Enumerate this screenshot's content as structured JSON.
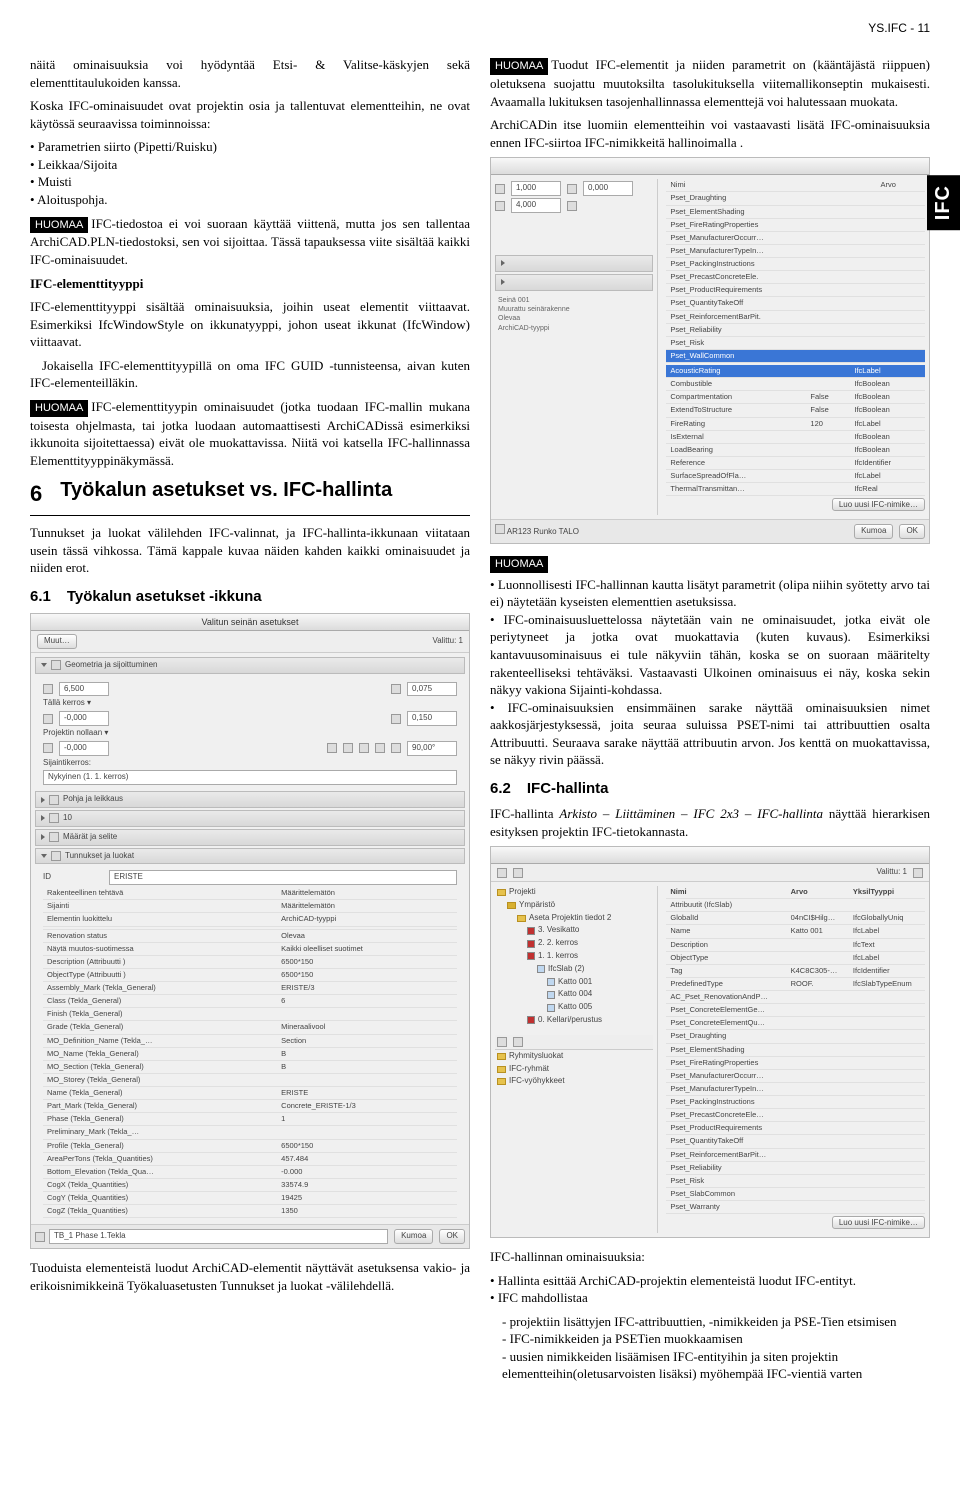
{
  "header": {
    "pageref": "YS.IFC - 11"
  },
  "sidetab": "IFC",
  "left": {
    "p1": "näitä ominaisuuksia voi hyödyntää Etsi- & Valitse-käskyjen sekä elementtitaulukoiden kanssa.",
    "p2": "Koska IFC-ominaisuudet ovat projektin osia ja tallentuvat elementteihin, ne ovat käytössä seuraavissa toiminnoissa:",
    "list1": [
      "Parametrien siirto (Pipetti/Ruisku)",
      "Leikkaa/Sijoita",
      "Muisti",
      "Aloituspohja."
    ],
    "note1": "IFC-tiedostoa ei voi suoraan käyttää viittenä, mutta jos sen tallentaa ArchiCAD.PLN-tiedostoksi, sen voi sijoittaa. Tässä tapauksessa viite sisältää kaikki IFC-ominaisuudet.",
    "h1": "IFC-elementtityyppi",
    "p3": "IFC-elementtityyppi sisältää ominaisuuksia, joihin useat elementit viittaavat. Esimerkiksi IfcWindowStyle on ikkunatyyppi, johon useat ikkunat (IfcWindow) viittaavat.",
    "p4": "Jokaisella IFC-elementtityypillä on oma IFC GUID -tunnisteensa, aivan kuten IFC-elementeilläkin.",
    "note2": "IFC-elementtityypin ominaisuudet (jotka tuodaan IFC-mallin mukana toisesta ohjelmasta, tai jotka luodaan automaattisesti ArchiCADissä esimerkiksi ikkunoita sijoitettaessa) eivät ole muokattavissa. Niitä voi katsella IFC-hallinnassa Elementtityyppinäkymässä.",
    "sec6num": "6",
    "sec6title": "Työkalun asetukset vs. IFC-hallinta",
    "p5": "Tunnukset ja luokat välilehden IFC-valinnat, ja IFC-hallinta-ikkunaan viitataan usein tässä vihkossa. Tämä kappale kuvaa näiden kahden kaikki ominaisuudet ja niiden erot.",
    "sub61num": "6.1",
    "sub61title": "Työkalun asetukset -ikkuna",
    "p6": "Tuoduista elementeistä luodut ArchiCAD-elementit näyttävät asetuksensa vakio- ja erikoisnimikkeinä Työkaluasetusten Tunnukset ja luokat -välilehdellä.",
    "ss1": {
      "title": "Valitun seinän asetukset",
      "muut": "Muut…",
      "valittu": "Valittu: 1",
      "geom": "Geometria ja sijoittuminen",
      "v1": "6,500",
      "v2": "0,075",
      "v3": "-0,000",
      "v4": "0,150",
      "talla": "Tällä kerros ▾",
      "proj": "Projektin nollaan ▾",
      "v5": "-0,000",
      "angle": "90,00°",
      "sijk": "Sijaintikerros:",
      "ker": "Nykyinen (1. 1. kerros)",
      "pohja": "Pohja ja leikkaus",
      "n10": "10",
      "maarat": "Määrät ja selite",
      "tunn": "Tunnukset ja luokat",
      "id": "ID",
      "eriste": "ERISTE",
      "rows": [
        [
          "Rakenteellinen tehtävä",
          "Määrittelemätön"
        ],
        [
          "Sijainti",
          "Määrittelemätön"
        ],
        [
          "Elementin luokittelu",
          "ArchiCAD-tyyppi"
        ],
        [
          "",
          ""
        ],
        [
          "Renovation status",
          "Olevaa"
        ],
        [
          "Näytä muutos-suotimessa",
          "Kaikki oleelliset suotimet"
        ],
        [
          "Description (Attribuutti )",
          "6500*150"
        ],
        [
          "ObjectType (Attribuutti )",
          "6500*150"
        ],
        [
          "Assembly_Mark (Tekla_General)",
          "ERISTE/3"
        ],
        [
          "Class (Tekla_General)",
          "6"
        ],
        [
          "Finish (Tekla_General)",
          ""
        ],
        [
          "Grade (Tekla_General)",
          "Mineraalivool"
        ],
        [
          "MO_Definition_Name (Tekla_…",
          "Section"
        ],
        [
          "MO_Name (Tekla_General)",
          "B"
        ],
        [
          "MO_Section (Tekla_General)",
          "B"
        ],
        [
          "MO_Storey (Tekla_General)",
          ""
        ],
        [
          "Name (Tekla_General)",
          "ERISTE"
        ],
        [
          "Part_Mark (Tekla_General)",
          "Concrete_ERISTE-1/3"
        ],
        [
          "Phase (Tekla_General)",
          "1"
        ],
        [
          "Preliminary_Mark (Tekla_…",
          ""
        ],
        [
          "Profile (Tekla_General)",
          "6500*150"
        ],
        [
          "AreaPerTons (Tekla_Quantities)",
          "457.484"
        ],
        [
          "Bottom_Elevation (Tekla_Qua…",
          "-0.000"
        ],
        [
          "CogX (Tekla_Quantities)",
          "33574.9"
        ],
        [
          "CogY (Tekla_Quantities)",
          "19425"
        ],
        [
          "CogZ (Tekla_Quantities)",
          "1350"
        ]
      ],
      "layer": "TB_1 Phase 1.Tekla",
      "kumoa": "Kumoa",
      "ok": "OK"
    }
  },
  "right": {
    "note1": "Tuodut IFC-elementit ja niiden parametrit on (kääntäjästä riippuen) oletuksena suojattu muutoksilta tasolukituksella viitemallikonseptin mukaisesti. Avaamalla lukituksen tasojenhallinnassa elementtejä voi halutessaan muokata.",
    "p1": "ArchiCADin itse luomiin elementteihin voi vastaavasti lisätä IFC-ominaisuuksia ennen IFC-siirtoa IFC-nimikkeitä hallinoimalla .",
    "ss2": {
      "left1": "1,000",
      "left2": "0,000",
      "left3": "4,000",
      "props": [
        [
          "Nimi",
          "Arvo"
        ],
        [
          "Pset_Draughting",
          ""
        ],
        [
          "Pset_ElementShading",
          ""
        ],
        [
          "Pset_FireRatingProperties",
          ""
        ],
        [
          "Pset_ManufacturerOccurr…",
          ""
        ],
        [
          "Pset_ManufacturerTypeIn…",
          ""
        ],
        [
          "Pset_PackingInstructions",
          ""
        ],
        [
          "Pset_PrecastConcreteEle.",
          ""
        ],
        [
          "Pset_ProductRequirements",
          ""
        ],
        [
          "Pset_QuantityTakeOff",
          ""
        ],
        [
          "Pset_ReinforcementBarPit.",
          ""
        ],
        [
          "Pset_Reliability",
          ""
        ],
        [
          "Pset_Risk",
          ""
        ],
        [
          "Pset_WallCommon",
          ""
        ]
      ],
      "sel": [
        [
          "AcousticRating",
          "",
          "IfcLabel"
        ],
        [
          "Combustible",
          "",
          "IfcBoolean"
        ],
        [
          "Compartmentation",
          "False",
          "IfcBoolean"
        ],
        [
          "ExtendToStructure",
          "False",
          "IfcBoolean"
        ],
        [
          "FireRating",
          "120",
          "IfcLabel"
        ],
        [
          "IsExternal",
          "",
          "IfcBoolean"
        ],
        [
          "LoadBearing",
          "",
          "IfcBoolean"
        ],
        [
          "Reference",
          "",
          "IfcIdentifier"
        ],
        [
          "SurfaceSpreadOfFla…",
          "",
          "IfcLabel"
        ],
        [
          "ThermalTransmittan…",
          "",
          "IfcReal"
        ]
      ],
      "bottom": "AR123 Runko TALO",
      "kumoa": "Kumoa",
      "ok": "OK",
      "uusi": "Luo uusi IFC-nimike…"
    },
    "note2label": "HUOMAA",
    "list2": [
      "Luonnollisesti IFC-hallinnan kautta lisätyt parametrit (olipa niihin syötetty arvo tai ei) näytetään kyseisten elementtien asetuksissa.",
      "IFC-ominaisuusluettelossa näytetään vain ne ominaisuudet, jotka eivät ole periytyneet ja jotka ovat muokattavia (kuten kuvaus). Esimerkiksi kantavuusominaisuus ei tule näkyviin tähän, koska se on suoraan määritelty rakenteelliseksi tehtäväksi. Vastaavasti Ulkoinen ominaisuus ei näy, koska sekin näkyy vakiona Sijainti-kohdassa.",
      "IFC-ominaisuuksien ensimmäinen sarake näyttää ominaisuuksien nimet aakkosjärjestyksessä, joita seuraa suluissa PSET-nimi tai attribuuttien osalta Attribuutti. Seuraava sarake näyttää attribuutin arvon. Jos kenttä on muokattavissa, se näkyy rivin päässä."
    ],
    "sub62num": "6.2",
    "sub62title": "IFC-hallinta",
    "p2a": "IFC-hallinta ",
    "p2b": "Arkisto – Liittäminen – IFC 2x3 – IFC-hallinta",
    "p2c": " näyttää hierarkisen esityksen projektin IFC-tietokannasta.",
    "ss3": {
      "valittu": "Valittu: 1",
      "tree": [
        {
          "label": "Projekti",
          "type": "folder",
          "depth": 0
        },
        {
          "label": "Ympäristö",
          "type": "folder",
          "depth": 1,
          "color": "#d8b030"
        },
        {
          "label": "Aseta Projektin tiedot 2",
          "type": "folder",
          "depth": 2
        },
        {
          "label": "3. Vesikatto",
          "type": "item",
          "depth": 3,
          "color": "#c03030"
        },
        {
          "label": "2. 2. kerros",
          "type": "item",
          "depth": 3,
          "color": "#c03030"
        },
        {
          "label": "1. 1. kerros",
          "type": "item",
          "depth": 3,
          "color": "#c03030"
        },
        {
          "label": "IfcSlab (2)",
          "type": "item",
          "depth": 4
        },
        {
          "label": "Katto 001",
          "type": "item",
          "depth": 5
        },
        {
          "label": "Katto 004",
          "type": "item",
          "depth": 5
        },
        {
          "label": "Katto 005",
          "type": "item",
          "depth": 5
        },
        {
          "label": "0. Kellari/perustus",
          "type": "item",
          "depth": 3,
          "color": "#c03030"
        }
      ],
      "groups": [
        "Ryhmitysluokat",
        "IFC-ryhmät",
        "IFC-vyöhykkeet"
      ],
      "propsHeader": [
        "Nimi",
        "Arvo",
        "YksilTyyppi"
      ],
      "props": [
        [
          "Attribuutit (IfcSlab)",
          "",
          ""
        ],
        [
          "GlobalId",
          "04nCI$Hilg…",
          "IfcGloballyUniq"
        ],
        [
          "Name",
          "Katto 001",
          "IfcLabel"
        ],
        [
          "Description",
          "",
          "IfcText"
        ],
        [
          "ObjectType",
          "",
          "IfcLabel"
        ],
        [
          "Tag",
          "K4C8C305-…",
          "IfcIdentifier"
        ],
        [
          "PredefinedType",
          "ROOF.",
          "IfcSlabTypeEnum"
        ],
        [
          "AC_Pset_RenovationAndP…",
          "",
          ""
        ],
        [
          "Pset_ConcreteElementGe…",
          "",
          ""
        ],
        [
          "Pset_ConcreteElementQu…",
          "",
          ""
        ],
        [
          "Pset_Draughting",
          "",
          ""
        ],
        [
          "Pset_ElementShading",
          "",
          ""
        ],
        [
          "Pset_FireRatingProperties",
          "",
          ""
        ],
        [
          "Pset_ManufacturerOccurr…",
          "",
          ""
        ],
        [
          "Pset_ManufacturerTypeIn…",
          "",
          ""
        ],
        [
          "Pset_PackingInstructions",
          "",
          ""
        ],
        [
          "Pset_PrecastConcreteEle…",
          "",
          ""
        ],
        [
          "Pset_ProductRequirements",
          "",
          ""
        ],
        [
          "Pset_QuantityTakeOff",
          "",
          ""
        ],
        [
          "Pset_ReinforcementBarPit…",
          "",
          ""
        ],
        [
          "Pset_Reliability",
          "",
          ""
        ],
        [
          "Pset_Risk",
          "",
          ""
        ],
        [
          "Pset_SlabCommon",
          "",
          ""
        ],
        [
          "Pset_Warranty",
          "",
          ""
        ]
      ],
      "uusi": "Luo uusi IFC-nimike…"
    },
    "p3": "IFC-hallinnan ominaisuuksia:",
    "list3": [
      "Hallinta esittää ArchiCAD-projektin elementeistä luodut IFC-entityt.",
      "IFC mahdollistaa"
    ],
    "sub3": [
      "- projektiin lisättyjen IFC-attribuuttien, -nimikkeiden ja PSE-Tien etsimisen",
      "- IFC-nimikkeiden ja PSETien muokkaamisen",
      "- uusien nimikkeiden lisäämisen IFC-entityihin ja siten projektin elementteihin(oletusarvoisten lisäksi) myöhempää IFC-vientiä varten"
    ]
  },
  "badge": "HUOMAA"
}
